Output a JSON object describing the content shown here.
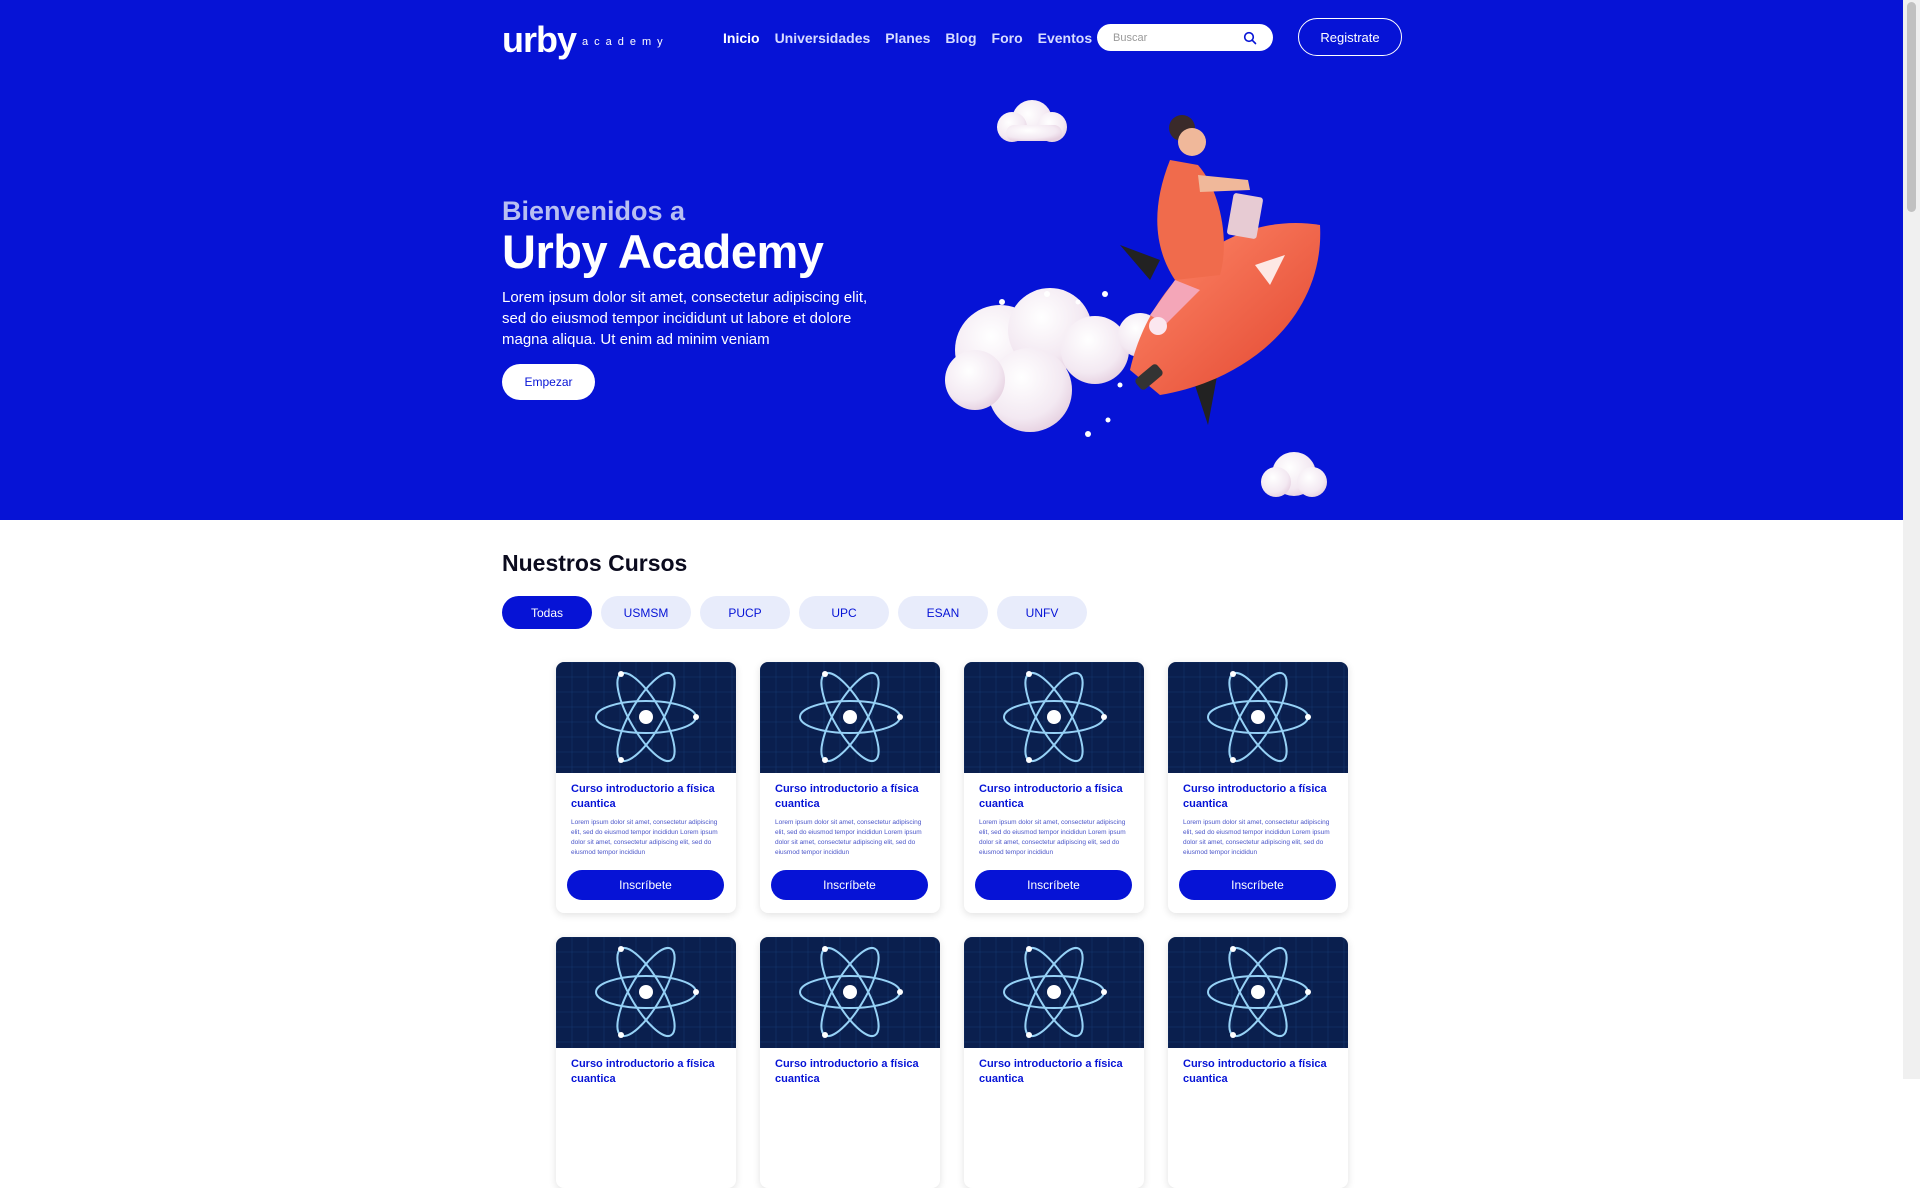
{
  "header": {
    "logo_main": "urby",
    "logo_sub": "academy",
    "nav": [
      {
        "label": "Inicio",
        "active": true
      },
      {
        "label": "Universidades",
        "active": false
      },
      {
        "label": "Planes",
        "active": false
      },
      {
        "label": "Blog",
        "active": false
      },
      {
        "label": "Foro",
        "active": false
      },
      {
        "label": "Eventos",
        "active": false
      }
    ],
    "search_placeholder": "Buscar",
    "register_label": "Registrate"
  },
  "hero": {
    "welcome": "Bienvenidos a",
    "title": "Urby Academy",
    "description": "Lorem ipsum dolor sit amet, consectetur adipiscing elit, sed do eiusmod tempor incididunt ut labore et dolore magna aliqua. Ut enim ad minim veniam",
    "start_label": "Empezar"
  },
  "courses": {
    "title": "Nuestros Cursos",
    "filters": [
      {
        "label": "Todas",
        "active": true
      },
      {
        "label": "USMSM",
        "active": false
      },
      {
        "label": "PUCP",
        "active": false
      },
      {
        "label": "UPC",
        "active": false
      },
      {
        "label": "ESAN",
        "active": false
      },
      {
        "label": "UNFV",
        "active": false
      }
    ],
    "cards": [
      {
        "title": "Curso introductorio a física cuantica",
        "description": "Lorem ipsum dolor sit amet, consectetur adipiscing elit, sed do eiusmod tempor incididun Lorem ipsum dolor sit amet, consectetur adipiscing elit, sed do eiusmod tempor incididun",
        "button": "Inscríbete"
      },
      {
        "title": "Curso introductorio a física cuantica",
        "description": "Lorem ipsum dolor sit amet, consectetur adipiscing elit, sed do eiusmod tempor incididun Lorem ipsum dolor sit amet, consectetur adipiscing elit, sed do eiusmod tempor incididun",
        "button": "Inscríbete"
      },
      {
        "title": "Curso introductorio a física cuantica",
        "description": "Lorem ipsum dolor sit amet, consectetur adipiscing elit, sed do eiusmod tempor incididun Lorem ipsum dolor sit amet, consectetur adipiscing elit, sed do eiusmod tempor incididun",
        "button": "Inscríbete"
      },
      {
        "title": "Curso introductorio a física cuantica",
        "description": "Lorem ipsum dolor sit amet, consectetur adipiscing elit, sed do eiusmod tempor incididun Lorem ipsum dolor sit amet, consectetur adipiscing elit, sed do eiusmod tempor incididun",
        "button": "Inscríbete"
      },
      {
        "title": "Curso introductorio a física cuantica",
        "description": "",
        "button": ""
      },
      {
        "title": "Curso introductorio a física cuantica",
        "description": "",
        "button": ""
      },
      {
        "title": "Curso introductorio a física cuantica",
        "description": "",
        "button": ""
      },
      {
        "title": "Curso introductorio a física cuantica",
        "description": "",
        "button": ""
      }
    ]
  },
  "colors": {
    "primary": "#0613d6",
    "accent": "#f26a4b",
    "card_image_bg": "#0a1f4e"
  },
  "icons": {
    "search": "search-icon",
    "hero_art": "rocket-illustration",
    "course_image": "atom-icon"
  }
}
